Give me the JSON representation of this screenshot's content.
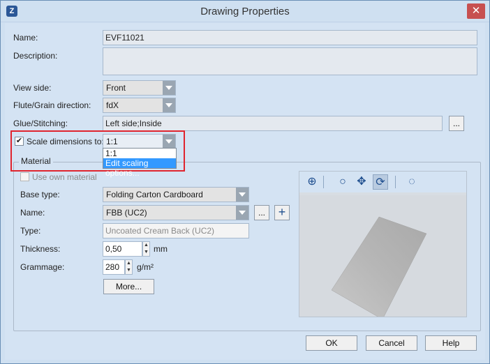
{
  "window": {
    "title": "Drawing Properties",
    "app_icon": "Z",
    "close_glyph": "✕"
  },
  "labels": {
    "name": "Name:",
    "description": "Description:",
    "view_side": "View side:",
    "flute": "Flute/Grain direction:",
    "glue": "Glue/Stitching:",
    "scale": "Scale dimensions to:",
    "material_group": "Material",
    "use_own_material": "Use own material",
    "base_type": "Base type:",
    "mat_name": "Name:",
    "type": "Type:",
    "thickness": "Thickness:",
    "grammage": "Grammage:",
    "thickness_unit": "mm",
    "grammage_unit": "g/m²"
  },
  "values": {
    "name": "EVF11021",
    "description": "",
    "view_side": "Front",
    "flute": "fdX",
    "glue": "Left side;Inside",
    "scale": "1:1",
    "base_type": "Folding Carton Cardboard",
    "mat_name": "FBB (UC2)",
    "type": "Uncoated Cream Back (UC2)",
    "thickness": "0,50",
    "grammage": "280"
  },
  "scale_dropdown": {
    "options": [
      "1:1",
      "Edit scaling options..."
    ],
    "highlighted_index": 1
  },
  "checkbox_glyph": "✔",
  "buttons": {
    "glue_browse": "...",
    "mat_browse": "...",
    "mat_add": "+",
    "more": "More...",
    "ok": "OK",
    "cancel": "Cancel",
    "help": "Help"
  },
  "preview_tools": [
    {
      "name": "zoom-fit-icon",
      "glyph": "⊕"
    },
    {
      "name": "zoom-icon",
      "glyph": "○"
    },
    {
      "name": "pan-icon",
      "glyph": "✥"
    },
    {
      "name": "rotate-icon",
      "glyph": "⟳"
    },
    {
      "name": "lightbulb-icon",
      "glyph": "◌"
    }
  ],
  "colors": {
    "highlight": "#e0242e",
    "dropdown_selection": "#3399ff",
    "close_button": "#c75050"
  }
}
